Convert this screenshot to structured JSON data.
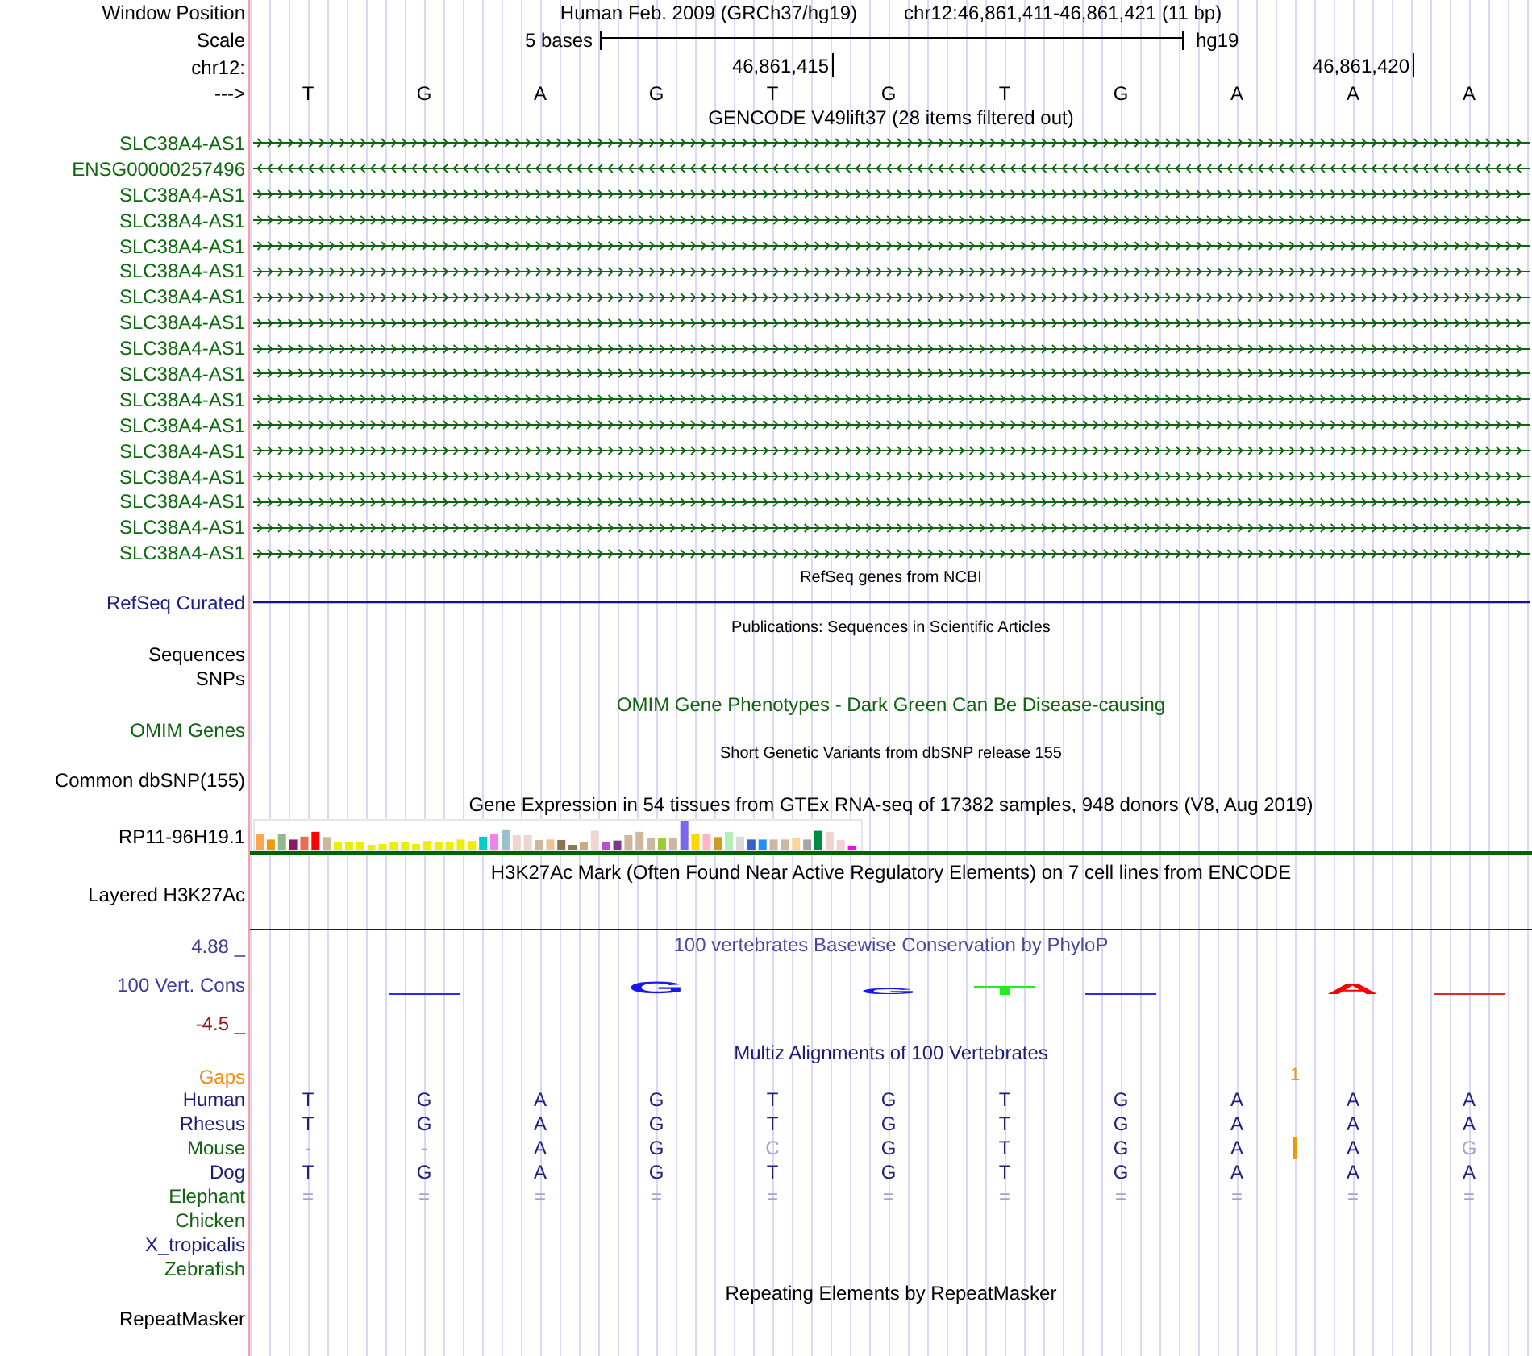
{
  "ruler": {
    "position_label": "Window Position",
    "assembly": "Human Feb. 2009 (GRCh37/hg19)",
    "position": "chr12:46,861,411-46,861,421 (11 bp)",
    "scale_label": "Scale",
    "scale_text": "5 bases",
    "scale_db": "hg19",
    "chrom_label": "chr12:",
    "strand_label": "--->",
    "bases": [
      {
        "base": "T"
      },
      {
        "base": "G"
      },
      {
        "base": "A"
      },
      {
        "base": "G"
      },
      {
        "base": "T",
        "coordinate": "46,861,415"
      },
      {
        "base": "G"
      },
      {
        "base": "T"
      },
      {
        "base": "G"
      },
      {
        "base": "A"
      },
      {
        "base": "A",
        "coordinate": "46,861,420"
      },
      {
        "base": "A"
      }
    ]
  },
  "tracks": [
    {
      "kind": "genes",
      "title": "GENCODE V49lift37 (28 items filtered out)",
      "items": [
        {
          "name": "SLC38A4-AS1",
          "reverse": false
        },
        {
          "name": "ENSG00000257496",
          "reverse": true
        },
        {
          "name": "SLC38A4-AS1",
          "reverse": false
        },
        {
          "name": "SLC38A4-AS1",
          "reverse": false
        },
        {
          "name": "SLC38A4-AS1",
          "reverse": false
        },
        {
          "name": "SLC38A4-AS1",
          "reverse": false
        },
        {
          "name": "SLC38A4-AS1",
          "reverse": false
        },
        {
          "name": "SLC38A4-AS1",
          "reverse": false
        },
        {
          "name": "SLC38A4-AS1",
          "reverse": false
        },
        {
          "name": "SLC38A4-AS1",
          "reverse": false
        },
        {
          "name": "SLC38A4-AS1",
          "reverse": false
        },
        {
          "name": "SLC38A4-AS1",
          "reverse": false
        },
        {
          "name": "SLC38A4-AS1",
          "reverse": false
        },
        {
          "name": "SLC38A4-AS1",
          "reverse": false
        },
        {
          "name": "SLC38A4-AS1",
          "reverse": false
        },
        {
          "name": "SLC38A4-AS1",
          "reverse": false
        },
        {
          "name": "SLC38A4-AS1",
          "reverse": false
        }
      ]
    },
    {
      "kind": "refseq",
      "title": "RefSeq genes from NCBI",
      "label": "RefSeq Curated"
    },
    {
      "kind": "publications",
      "title": "Publications: Sequences in Scientific Articles",
      "labels": [
        "Sequences",
        "SNPs"
      ]
    },
    {
      "kind": "omim",
      "title": "OMIM Gene Phenotypes - Dark Green Can Be Disease-causing",
      "labels": [
        "OMIM Genes"
      ]
    },
    {
      "kind": "snps",
      "title": "Short Genetic Variants from dbSNP release 155",
      "labels": [
        "Common dbSNP(155)"
      ]
    },
    {
      "kind": "expression",
      "title": "Gene Expression in 54 tissues from GTEx RNA-seq of 17382 samples, 948 donors (V8, Aug 2019)",
      "label": "RP11-96H19.1"
    },
    {
      "kind": "signal",
      "title": "H3K27Ac Mark (Often Found Near Active Regulatory Elements) on 7 cell lines from ENCODE",
      "label": "Layered H3K27Ac"
    },
    {
      "kind": "conservation",
      "title": "100 vertebrates Basewise Conservation by PhyloP",
      "upper": "4.88 _",
      "label": "100 Vert. Cons",
      "lower": "-4.5 _",
      "marks": [
        {
          "kind": "blank"
        },
        {
          "kind": "line",
          "color": "#2a2af0"
        },
        {
          "kind": "blank"
        },
        {
          "kind": "letter",
          "letter": "G",
          "color": "#1818ee"
        },
        {
          "kind": "blank"
        },
        {
          "kind": "letter",
          "letter": "G",
          "color": "#1818ee"
        },
        {
          "kind": "marker",
          "color": "#22ee22"
        },
        {
          "kind": "line",
          "color": "#2a2af0"
        },
        {
          "kind": "blank"
        },
        {
          "kind": "letter",
          "letter": "A",
          "color": "#ff0000"
        },
        {
          "kind": "line",
          "color": "#ee2222"
        }
      ]
    },
    {
      "kind": "alignment",
      "title": "Multiz Alignments of 100 Vertebrates",
      "gaps": {
        "label": "Gaps",
        "cells": [
          {
            "kind": "blank"
          },
          {
            "kind": "blank"
          },
          {
            "kind": "blank"
          },
          {
            "kind": "blank"
          },
          {
            "kind": "blank"
          },
          {
            "kind": "blank"
          },
          {
            "kind": "blank"
          },
          {
            "kind": "blank"
          },
          {
            "kind": "blank"
          },
          {
            "kind": "count",
            "text": "1"
          },
          {
            "kind": "blank"
          },
          {
            "kind": "blank"
          }
        ]
      },
      "species": [
        {
          "name": "Human",
          "color": "#1c1c78",
          "cells": [
            {
              "kind": "base",
              "base": "T",
              "faded": false
            },
            {
              "kind": "base",
              "base": "G",
              "faded": false
            },
            {
              "kind": "base",
              "base": "A",
              "faded": false
            },
            {
              "kind": "base",
              "base": "G",
              "faded": false
            },
            {
              "kind": "base",
              "base": "T",
              "faded": false
            },
            {
              "kind": "base",
              "base": "G",
              "faded": false
            },
            {
              "kind": "base",
              "base": "T",
              "faded": false
            },
            {
              "kind": "base",
              "base": "G",
              "faded": false
            },
            {
              "kind": "base",
              "base": "A",
              "faded": false
            },
            {
              "kind": "base",
              "base": "A",
              "faded": false
            },
            {
              "kind": "base",
              "base": "A",
              "faded": false
            }
          ]
        },
        {
          "name": "Rhesus",
          "color": "#1c1c78",
          "cells": [
            {
              "kind": "base",
              "base": "T",
              "faded": false
            },
            {
              "kind": "base",
              "base": "G",
              "faded": false
            },
            {
              "kind": "base",
              "base": "A",
              "faded": false
            },
            {
              "kind": "base",
              "base": "G",
              "faded": false
            },
            {
              "kind": "base",
              "base": "T",
              "faded": false
            },
            {
              "kind": "base",
              "base": "G",
              "faded": false
            },
            {
              "kind": "base",
              "base": "T",
              "faded": false
            },
            {
              "kind": "base",
              "base": "G",
              "faded": false
            },
            {
              "kind": "base",
              "base": "A",
              "faded": false
            },
            {
              "kind": "base",
              "base": "A",
              "faded": false
            },
            {
              "kind": "base",
              "base": "A",
              "faded": false
            }
          ]
        },
        {
          "name": "Mouse",
          "color": "#0f650f",
          "cells": [
            {
              "kind": "base",
              "base": "-",
              "faded": true
            },
            {
              "kind": "base",
              "base": "-",
              "faded": true
            },
            {
              "kind": "base",
              "base": "A",
              "faded": false
            },
            {
              "kind": "base",
              "base": "G",
              "faded": false
            },
            {
              "kind": "base",
              "base": "C",
              "faded": true
            },
            {
              "kind": "base",
              "base": "G",
              "faded": false
            },
            {
              "kind": "base",
              "base": "T",
              "faded": false
            },
            {
              "kind": "base",
              "base": "G",
              "faded": false
            },
            {
              "kind": "base",
              "base": "A",
              "faded": false
            },
            {
              "kind": "insert"
            },
            {
              "kind": "base",
              "base": "A",
              "faded": false
            },
            {
              "kind": "base",
              "base": "G",
              "faded": true
            }
          ]
        },
        {
          "name": "Dog",
          "color": "#1c1c78",
          "cells": [
            {
              "kind": "base",
              "base": "T",
              "faded": false
            },
            {
              "kind": "base",
              "base": "G",
              "faded": false
            },
            {
              "kind": "base",
              "base": "A",
              "faded": false
            },
            {
              "kind": "base",
              "base": "G",
              "faded": false
            },
            {
              "kind": "base",
              "base": "T",
              "faded": false
            },
            {
              "kind": "base",
              "base": "G",
              "faded": false
            },
            {
              "kind": "base",
              "base": "T",
              "faded": false
            },
            {
              "kind": "base",
              "base": "G",
              "faded": false
            },
            {
              "kind": "base",
              "base": "A",
              "faded": false
            },
            {
              "kind": "base",
              "base": "A",
              "faded": false
            },
            {
              "kind": "base",
              "base": "A",
              "faded": false
            }
          ]
        },
        {
          "name": "Elephant",
          "color": "#0f650f",
          "cells": [
            {
              "kind": "base",
              "base": "=",
              "faded": true
            },
            {
              "kind": "base",
              "base": "=",
              "faded": true
            },
            {
              "kind": "base",
              "base": "=",
              "faded": true
            },
            {
              "kind": "base",
              "base": "=",
              "faded": true
            },
            {
              "kind": "base",
              "base": "=",
              "faded": true
            },
            {
              "kind": "base",
              "base": "=",
              "faded": true
            },
            {
              "kind": "base",
              "base": "=",
              "faded": true
            },
            {
              "kind": "base",
              "base": "=",
              "faded": true
            },
            {
              "kind": "base",
              "base": "=",
              "faded": true
            },
            {
              "kind": "base",
              "base": "=",
              "faded": true
            },
            {
              "kind": "base",
              "base": "=",
              "faded": true
            }
          ]
        },
        {
          "name": "Chicken",
          "color": "#0f650f"
        },
        {
          "name": "X_tropicalis",
          "color": "#1c1c78"
        },
        {
          "name": "Zebrafish",
          "color": "#0f650f"
        }
      ]
    },
    {
      "kind": "repeats",
      "title": "Repeating Elements by RepeatMasker",
      "labels": [
        "RepeatMasker"
      ]
    }
  ]
}
